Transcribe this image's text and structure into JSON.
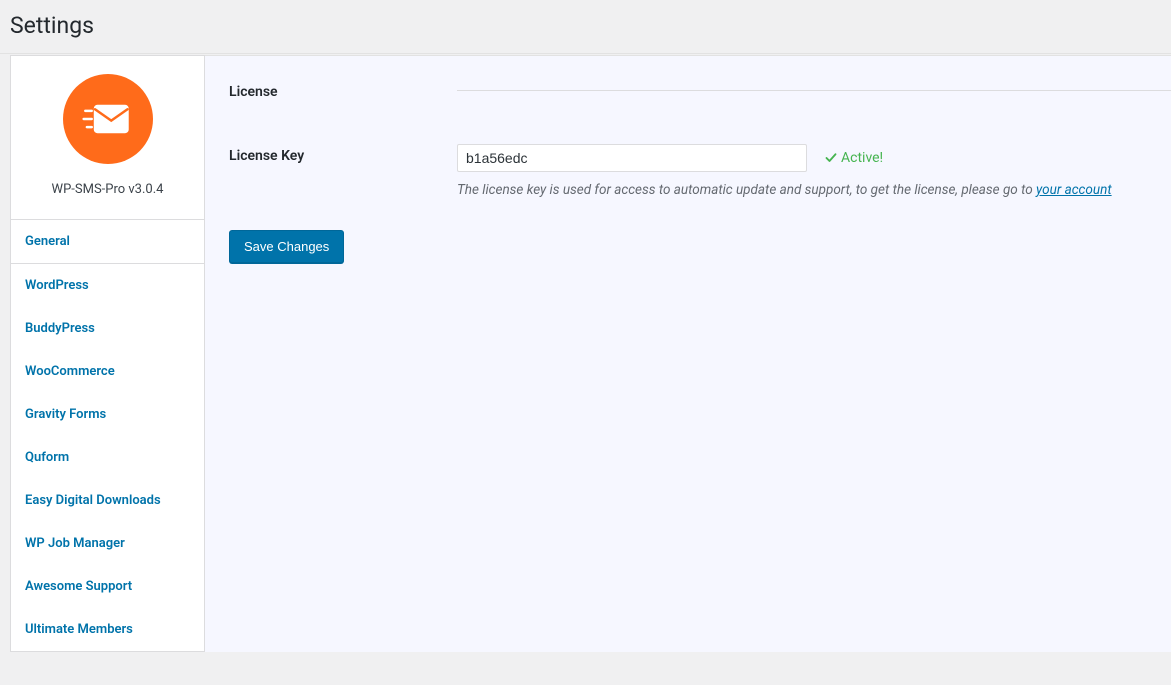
{
  "header": {
    "title": "Settings"
  },
  "plugin": {
    "name": "WP-SMS-Pro v3.0.4"
  },
  "tabs": [
    {
      "label": "General",
      "active": true
    },
    {
      "label": "WordPress",
      "active": false
    },
    {
      "label": "BuddyPress",
      "active": false
    },
    {
      "label": "WooCommerce",
      "active": false
    },
    {
      "label": "Gravity Forms",
      "active": false
    },
    {
      "label": "Quform",
      "active": false
    },
    {
      "label": "Easy Digital Downloads",
      "active": false
    },
    {
      "label": "WP Job Manager",
      "active": false
    },
    {
      "label": "Awesome Support",
      "active": false
    },
    {
      "label": "Ultimate Members",
      "active": false
    }
  ],
  "license": {
    "section_label": "License",
    "key_label": "License Key",
    "key_value": "b1a56edc",
    "status_text": "Active!",
    "help_prefix": "The license key is used for access to automatic update and support, to get the license, please go to ",
    "help_link_text": "your account"
  },
  "actions": {
    "save_label": "Save Changes"
  }
}
